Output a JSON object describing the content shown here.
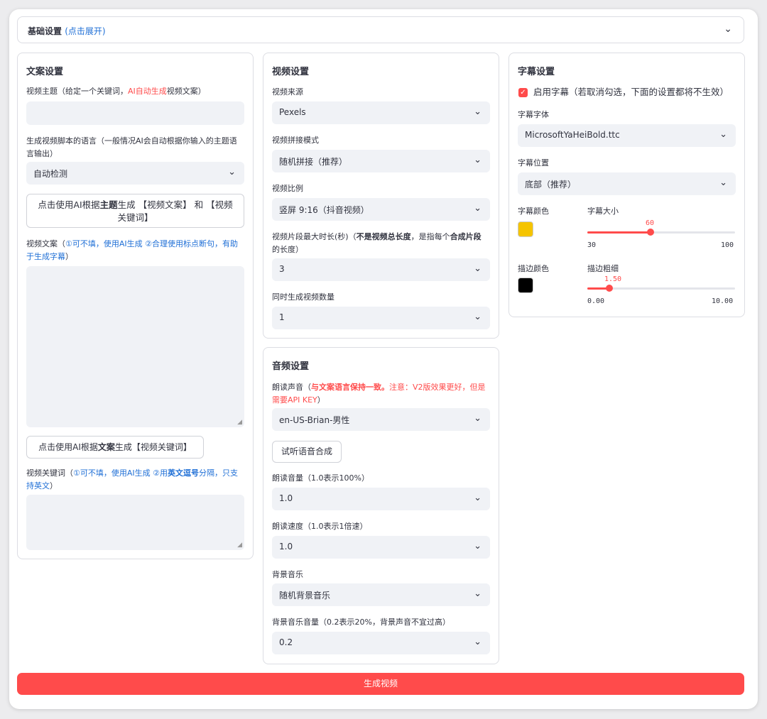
{
  "basic": {
    "title": "基础设置",
    "expand": "(点击展开)"
  },
  "copy": {
    "title": "文案设置",
    "subject_label_a": "视频主题（给定一个关键词，",
    "subject_label_red": "AI自动生成",
    "subject_label_b": "视频文案）",
    "subject_value": "",
    "lang_label_1": "生成视频脚本的语言（一般情况AI会自动根据你输入的主题语",
    "lang_label_2": "言输出）",
    "lang_value": "自动检测",
    "gen_btn_1a": "点击使用AI根据",
    "gen_btn_1b": "主题",
    "gen_btn_1c": "生成 【视频文案】 和 【视频",
    "gen_btn_2": "关键词】",
    "script_label_a": "视频文案（",
    "script_label_blue_1": "①可不填，使用AI生成 ②合理使用标点断句，有助",
    "script_label_blue_2": "于生成字幕",
    "script_label_c": "）",
    "script_value": "",
    "kw_btn_a": "点击使用AI根据",
    "kw_btn_b": "文案",
    "kw_btn_c": "生成【视频关键词】",
    "kw_label_a": "视频关键词（",
    "kw_label_blue_1": "①可不填，使用AI生成 ②用",
    "kw_label_bold": "英文逗号",
    "kw_label_blue_2": "分隔，只支",
    "kw_label_blue_3": "持英文",
    "kw_label_c": "）",
    "kw_value": ""
  },
  "video": {
    "title": "视频设置",
    "source_label": "视频来源",
    "source_value": "Pexels",
    "concat_label": "视频拼接模式",
    "concat_value": "随机拼接（推荐）",
    "ratio_label": "视频比例",
    "ratio_value": "竖屏 9:16（抖音视频）",
    "clip_label_a": "视频片段最大时长(秒)（",
    "clip_label_b": "不是视频总长度",
    "clip_label_c": "，是指每个",
    "clip_label_d": "合成片段",
    "clip_label_2": "的长度）",
    "clip_value": "3",
    "count_label": "同时生成视频数量",
    "count_value": "1"
  },
  "audio": {
    "title": "音频设置",
    "voice_label_a": "朗读声音（",
    "voice_label_red_1": "与文案语言保持一致。",
    "voice_label_red_2": "注意：V2版效果更好，但是",
    "voice_label_red_3": "需要API KEY",
    "voice_label_c": "）",
    "voice_value": "en-US-Brian-男性",
    "test_btn": "试听语音合成",
    "volume_label": "朗读音量（1.0表示100%）",
    "volume_value": "1.0",
    "speed_label": "朗读速度（1.0表示1倍速）",
    "speed_value": "1.0",
    "bgm_label": "背景音乐",
    "bgm_value": "随机背景音乐",
    "bgm_volume_label": "背景音乐音量（0.2表示20%，背景声音不宜过高）",
    "bgm_volume_value": "0.2"
  },
  "subtitle": {
    "title": "字幕设置",
    "enable_label": "启用字幕（若取消勾选，下面的设置都将不生效）",
    "enable_checked": true,
    "font_label": "字幕字体",
    "font_value": "MicrosoftYaHeiBold.ttc",
    "position_label": "字幕位置",
    "position_value": "底部（推荐）",
    "color_label": "字幕颜色",
    "color_value": "#f5c400",
    "size_label": "字幕大小",
    "size_value": "60",
    "size_min": "30",
    "size_max": "100",
    "size_fraction": 0.4286,
    "stroke_color_label": "描边颜色",
    "stroke_color_value": "#000000",
    "stroke_width_label": "描边粗细",
    "stroke_width_value": "1.50",
    "stroke_min": "0.00",
    "stroke_max": "10.00",
    "stroke_fraction": 0.15
  },
  "generate_button": "生成视频"
}
